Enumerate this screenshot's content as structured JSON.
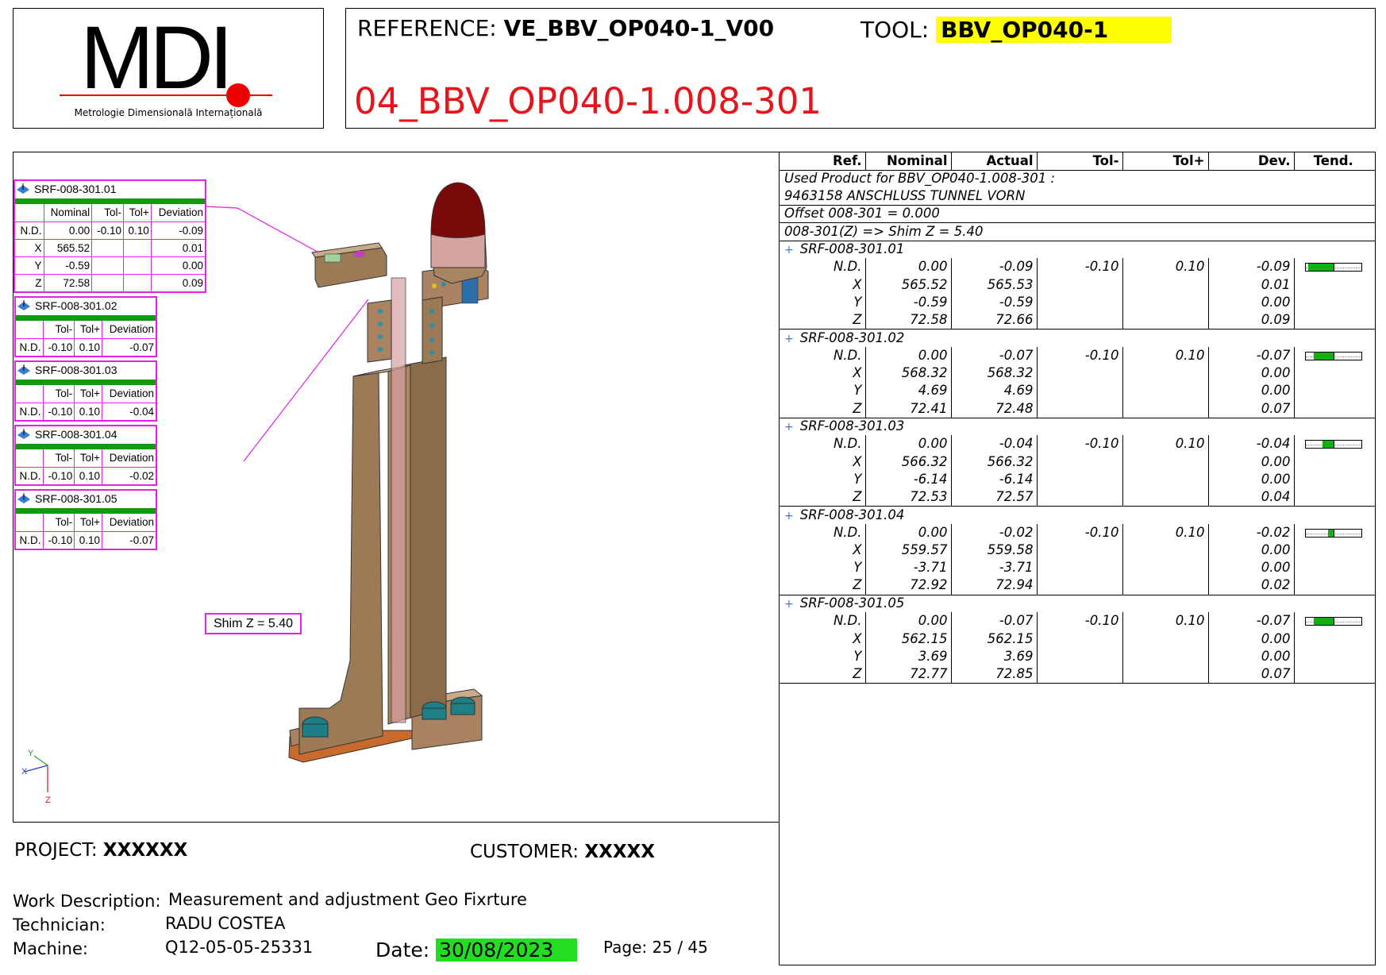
{
  "logo": {
    "text": "MDI",
    "subtitle": "Metrologie Dimensională Internațională"
  },
  "header": {
    "reference_label": "REFERENCE:",
    "reference_value": "VE_BBV_OP040-1_V00",
    "tool_label": "TOOL:",
    "tool_value": "BBV_OP040-1",
    "code": "04_BBV_OP040-1.008-301",
    "tool_highlight_color": "#ffff00",
    "code_color": "#e8141b"
  },
  "table": {
    "headers": [
      "Ref.",
      "Nominal",
      "Actual",
      "Tol-",
      "Tol+",
      "Dev.",
      "Tend."
    ],
    "info": [
      "Used Product for BBV_OP040-1.008-301 :",
      "9463158 ANSCHLUSS TUNNEL VORN",
      "Offset 008-301 = 0.000",
      "008-301(Z) =>  Shim Z = 5.40"
    ],
    "features": [
      {
        "name": "SRF-008-301.01",
        "tend": -0.09,
        "rows": [
          {
            "ref": "N.D.",
            "nominal": "0.00",
            "actual": "-0.09",
            "tol_minus": "-0.10",
            "tol_plus": "0.10",
            "dev": "-0.09"
          },
          {
            "ref": "X",
            "nominal": "565.52",
            "actual": "565.53",
            "tol_minus": "",
            "tol_plus": "",
            "dev": "0.01"
          },
          {
            "ref": "Y",
            "nominal": "-0.59",
            "actual": "-0.59",
            "tol_minus": "",
            "tol_plus": "",
            "dev": "0.00"
          },
          {
            "ref": "Z",
            "nominal": "72.58",
            "actual": "72.66",
            "tol_minus": "",
            "tol_plus": "",
            "dev": "0.09"
          }
        ]
      },
      {
        "name": "SRF-008-301.02",
        "tend": -0.07,
        "rows": [
          {
            "ref": "N.D.",
            "nominal": "0.00",
            "actual": "-0.07",
            "tol_minus": "-0.10",
            "tol_plus": "0.10",
            "dev": "-0.07"
          },
          {
            "ref": "X",
            "nominal": "568.32",
            "actual": "568.32",
            "tol_minus": "",
            "tol_plus": "",
            "dev": "0.00"
          },
          {
            "ref": "Y",
            "nominal": "4.69",
            "actual": "4.69",
            "tol_minus": "",
            "tol_plus": "",
            "dev": "0.00"
          },
          {
            "ref": "Z",
            "nominal": "72.41",
            "actual": "72.48",
            "tol_minus": "",
            "tol_plus": "",
            "dev": "0.07"
          }
        ]
      },
      {
        "name": "SRF-008-301.03",
        "tend": -0.04,
        "rows": [
          {
            "ref": "N.D.",
            "nominal": "0.00",
            "actual": "-0.04",
            "tol_minus": "-0.10",
            "tol_plus": "0.10",
            "dev": "-0.04"
          },
          {
            "ref": "X",
            "nominal": "566.32",
            "actual": "566.32",
            "tol_minus": "",
            "tol_plus": "",
            "dev": "0.00"
          },
          {
            "ref": "Y",
            "nominal": "-6.14",
            "actual": "-6.14",
            "tol_minus": "",
            "tol_plus": "",
            "dev": "0.00"
          },
          {
            "ref": "Z",
            "nominal": "72.53",
            "actual": "72.57",
            "tol_minus": "",
            "tol_plus": "",
            "dev": "0.04"
          }
        ]
      },
      {
        "name": "SRF-008-301.04",
        "tend": -0.02,
        "rows": [
          {
            "ref": "N.D.",
            "nominal": "0.00",
            "actual": "-0.02",
            "tol_minus": "-0.10",
            "tol_plus": "0.10",
            "dev": "-0.02"
          },
          {
            "ref": "X",
            "nominal": "559.57",
            "actual": "559.58",
            "tol_minus": "",
            "tol_plus": "",
            "dev": "0.00"
          },
          {
            "ref": "Y",
            "nominal": "-3.71",
            "actual": "-3.71",
            "tol_minus": "",
            "tol_plus": "",
            "dev": "0.00"
          },
          {
            "ref": "Z",
            "nominal": "72.92",
            "actual": "72.94",
            "tol_minus": "",
            "tol_plus": "",
            "dev": "0.02"
          }
        ]
      },
      {
        "name": "SRF-008-301.05",
        "tend": -0.07,
        "rows": [
          {
            "ref": "N.D.",
            "nominal": "0.00",
            "actual": "-0.07",
            "tol_minus": "-0.10",
            "tol_plus": "0.10",
            "dev": "-0.07"
          },
          {
            "ref": "X",
            "nominal": "562.15",
            "actual": "562.15",
            "tol_minus": "",
            "tol_plus": "",
            "dev": "0.00"
          },
          {
            "ref": "Y",
            "nominal": "3.69",
            "actual": "3.69",
            "tol_minus": "",
            "tol_plus": "",
            "dev": "0.00"
          },
          {
            "ref": "Z",
            "nominal": "72.77",
            "actual": "72.85",
            "tol_minus": "",
            "tol_plus": "",
            "dev": "0.07"
          }
        ]
      }
    ]
  },
  "callouts": [
    {
      "name": "SRF-008-301.01",
      "headers": [
        "",
        "Nominal",
        "Tol-",
        "Tol+",
        "Deviation"
      ],
      "rows": [
        [
          "N.D.",
          "0.00",
          "-0.10",
          "0.10",
          "-0.09"
        ],
        [
          "X",
          "565.52",
          "",
          "",
          "0.01"
        ],
        [
          "Y",
          "-0.59",
          "",
          "",
          "0.00"
        ],
        [
          "Z",
          "72.58",
          "",
          "",
          "0.09"
        ]
      ]
    },
    {
      "name": "SRF-008-301.02",
      "headers": [
        "",
        "Tol-",
        "Tol+",
        "Deviation"
      ],
      "rows": [
        [
          "N.D.",
          "-0.10",
          "0.10",
          "-0.07"
        ]
      ]
    },
    {
      "name": "SRF-008-301.03",
      "headers": [
        "",
        "Tol-",
        "Tol+",
        "Deviation"
      ],
      "rows": [
        [
          "N.D.",
          "-0.10",
          "0.10",
          "-0.04"
        ]
      ]
    },
    {
      "name": "SRF-008-301.04",
      "headers": [
        "",
        "Tol-",
        "Tol+",
        "Deviation"
      ],
      "rows": [
        [
          "N.D.",
          "-0.10",
          "0.10",
          "-0.02"
        ]
      ]
    },
    {
      "name": "SRF-008-301.05",
      "headers": [
        "",
        "Tol-",
        "Tol+",
        "Deviation"
      ],
      "rows": [
        [
          "N.D.",
          "-0.10",
          "0.10",
          "-0.07"
        ]
      ]
    }
  ],
  "shim_label": "Shim Z = 5.40",
  "axes": {
    "x": "X",
    "y": "Y",
    "z": "Z"
  },
  "footer": {
    "project_label": "PROJECT:",
    "project_value": "XXXXXX",
    "customer_label": "CUSTOMER:",
    "customer_value": "XXXXX",
    "work_label": "Work Description:",
    "work_value": "Measurement and adjustment  Geo Fixrture",
    "technician_label": "Technician:",
    "technician_value": "RADU COSTEA",
    "machine_label": "Machine:",
    "machine_value": "Q12-05-05-25331",
    "date_label": "Date:",
    "date_value": "30/08/2023",
    "page_label": "Page:",
    "page_value": "25 / 45",
    "date_highlight_color": "#22dd22"
  }
}
